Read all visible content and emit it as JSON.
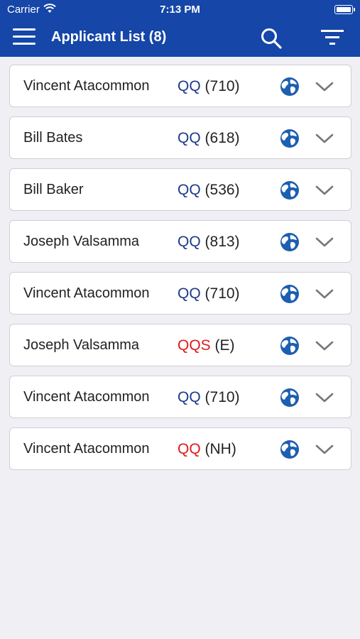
{
  "status_bar": {
    "carrier": "Carrier",
    "time": "7:13 PM"
  },
  "header": {
    "title": "Applicant List (8)"
  },
  "icons": {
    "menu": "hamburger-menu-icon",
    "search": "search-icon",
    "filter": "filter-icon",
    "globe": "globe-icon",
    "expand": "chevron-down-icon"
  },
  "colors": {
    "header_bg": "#1546a8",
    "qq_blue": "#1d3a8a",
    "qq_red": "#e0191b",
    "globe_blue": "#1d5fb0"
  },
  "applicants": [
    {
      "name": "Vincent Atacommon",
      "tag": "QQ",
      "tag_color": "#1d3a8a",
      "score": "(710)"
    },
    {
      "name": "Bill Bates",
      "tag": "QQ",
      "tag_color": "#1d3a8a",
      "score": "(618)"
    },
    {
      "name": "Bill Baker",
      "tag": "QQ",
      "tag_color": "#1d3a8a",
      "score": "(536)"
    },
    {
      "name": "Joseph Valsamma",
      "tag": "QQ",
      "tag_color": "#1d3a8a",
      "score": "(813)"
    },
    {
      "name": "Vincent Atacommon",
      "tag": "QQ",
      "tag_color": "#1d3a8a",
      "score": "(710)"
    },
    {
      "name": "Joseph Valsamma",
      "tag": "QQS",
      "tag_color": "#e0191b",
      "score": "(E)"
    },
    {
      "name": "Vincent Atacommon",
      "tag": "QQ",
      "tag_color": "#1d3a8a",
      "score": "(710)"
    },
    {
      "name": "Vincent Atacommon",
      "tag": "QQ",
      "tag_color": "#e0191b",
      "score": "(NH)"
    }
  ]
}
